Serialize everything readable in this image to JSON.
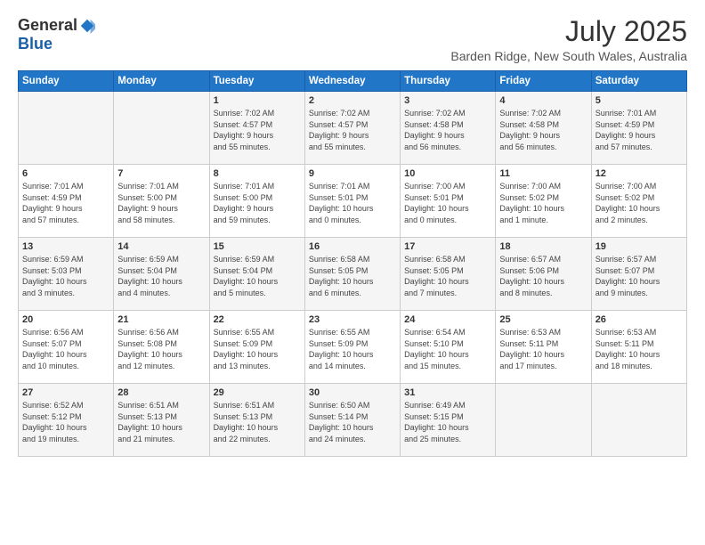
{
  "logo": {
    "general": "General",
    "blue": "Blue"
  },
  "title": {
    "month_year": "July 2025",
    "location": "Barden Ridge, New South Wales, Australia"
  },
  "days_of_week": [
    "Sunday",
    "Monday",
    "Tuesday",
    "Wednesday",
    "Thursday",
    "Friday",
    "Saturday"
  ],
  "weeks": [
    [
      {
        "day": "",
        "info": ""
      },
      {
        "day": "",
        "info": ""
      },
      {
        "day": "1",
        "info": "Sunrise: 7:02 AM\nSunset: 4:57 PM\nDaylight: 9 hours\nand 55 minutes."
      },
      {
        "day": "2",
        "info": "Sunrise: 7:02 AM\nSunset: 4:57 PM\nDaylight: 9 hours\nand 55 minutes."
      },
      {
        "day": "3",
        "info": "Sunrise: 7:02 AM\nSunset: 4:58 PM\nDaylight: 9 hours\nand 56 minutes."
      },
      {
        "day": "4",
        "info": "Sunrise: 7:02 AM\nSunset: 4:58 PM\nDaylight: 9 hours\nand 56 minutes."
      },
      {
        "day": "5",
        "info": "Sunrise: 7:01 AM\nSunset: 4:59 PM\nDaylight: 9 hours\nand 57 minutes."
      }
    ],
    [
      {
        "day": "6",
        "info": "Sunrise: 7:01 AM\nSunset: 4:59 PM\nDaylight: 9 hours\nand 57 minutes."
      },
      {
        "day": "7",
        "info": "Sunrise: 7:01 AM\nSunset: 5:00 PM\nDaylight: 9 hours\nand 58 minutes."
      },
      {
        "day": "8",
        "info": "Sunrise: 7:01 AM\nSunset: 5:00 PM\nDaylight: 9 hours\nand 59 minutes."
      },
      {
        "day": "9",
        "info": "Sunrise: 7:01 AM\nSunset: 5:01 PM\nDaylight: 10 hours\nand 0 minutes."
      },
      {
        "day": "10",
        "info": "Sunrise: 7:00 AM\nSunset: 5:01 PM\nDaylight: 10 hours\nand 0 minutes."
      },
      {
        "day": "11",
        "info": "Sunrise: 7:00 AM\nSunset: 5:02 PM\nDaylight: 10 hours\nand 1 minute."
      },
      {
        "day": "12",
        "info": "Sunrise: 7:00 AM\nSunset: 5:02 PM\nDaylight: 10 hours\nand 2 minutes."
      }
    ],
    [
      {
        "day": "13",
        "info": "Sunrise: 6:59 AM\nSunset: 5:03 PM\nDaylight: 10 hours\nand 3 minutes."
      },
      {
        "day": "14",
        "info": "Sunrise: 6:59 AM\nSunset: 5:04 PM\nDaylight: 10 hours\nand 4 minutes."
      },
      {
        "day": "15",
        "info": "Sunrise: 6:59 AM\nSunset: 5:04 PM\nDaylight: 10 hours\nand 5 minutes."
      },
      {
        "day": "16",
        "info": "Sunrise: 6:58 AM\nSunset: 5:05 PM\nDaylight: 10 hours\nand 6 minutes."
      },
      {
        "day": "17",
        "info": "Sunrise: 6:58 AM\nSunset: 5:05 PM\nDaylight: 10 hours\nand 7 minutes."
      },
      {
        "day": "18",
        "info": "Sunrise: 6:57 AM\nSunset: 5:06 PM\nDaylight: 10 hours\nand 8 minutes."
      },
      {
        "day": "19",
        "info": "Sunrise: 6:57 AM\nSunset: 5:07 PM\nDaylight: 10 hours\nand 9 minutes."
      }
    ],
    [
      {
        "day": "20",
        "info": "Sunrise: 6:56 AM\nSunset: 5:07 PM\nDaylight: 10 hours\nand 10 minutes."
      },
      {
        "day": "21",
        "info": "Sunrise: 6:56 AM\nSunset: 5:08 PM\nDaylight: 10 hours\nand 12 minutes."
      },
      {
        "day": "22",
        "info": "Sunrise: 6:55 AM\nSunset: 5:09 PM\nDaylight: 10 hours\nand 13 minutes."
      },
      {
        "day": "23",
        "info": "Sunrise: 6:55 AM\nSunset: 5:09 PM\nDaylight: 10 hours\nand 14 minutes."
      },
      {
        "day": "24",
        "info": "Sunrise: 6:54 AM\nSunset: 5:10 PM\nDaylight: 10 hours\nand 15 minutes."
      },
      {
        "day": "25",
        "info": "Sunrise: 6:53 AM\nSunset: 5:11 PM\nDaylight: 10 hours\nand 17 minutes."
      },
      {
        "day": "26",
        "info": "Sunrise: 6:53 AM\nSunset: 5:11 PM\nDaylight: 10 hours\nand 18 minutes."
      }
    ],
    [
      {
        "day": "27",
        "info": "Sunrise: 6:52 AM\nSunset: 5:12 PM\nDaylight: 10 hours\nand 19 minutes."
      },
      {
        "day": "28",
        "info": "Sunrise: 6:51 AM\nSunset: 5:13 PM\nDaylight: 10 hours\nand 21 minutes."
      },
      {
        "day": "29",
        "info": "Sunrise: 6:51 AM\nSunset: 5:13 PM\nDaylight: 10 hours\nand 22 minutes."
      },
      {
        "day": "30",
        "info": "Sunrise: 6:50 AM\nSunset: 5:14 PM\nDaylight: 10 hours\nand 24 minutes."
      },
      {
        "day": "31",
        "info": "Sunrise: 6:49 AM\nSunset: 5:15 PM\nDaylight: 10 hours\nand 25 minutes."
      },
      {
        "day": "",
        "info": ""
      },
      {
        "day": "",
        "info": ""
      }
    ]
  ]
}
